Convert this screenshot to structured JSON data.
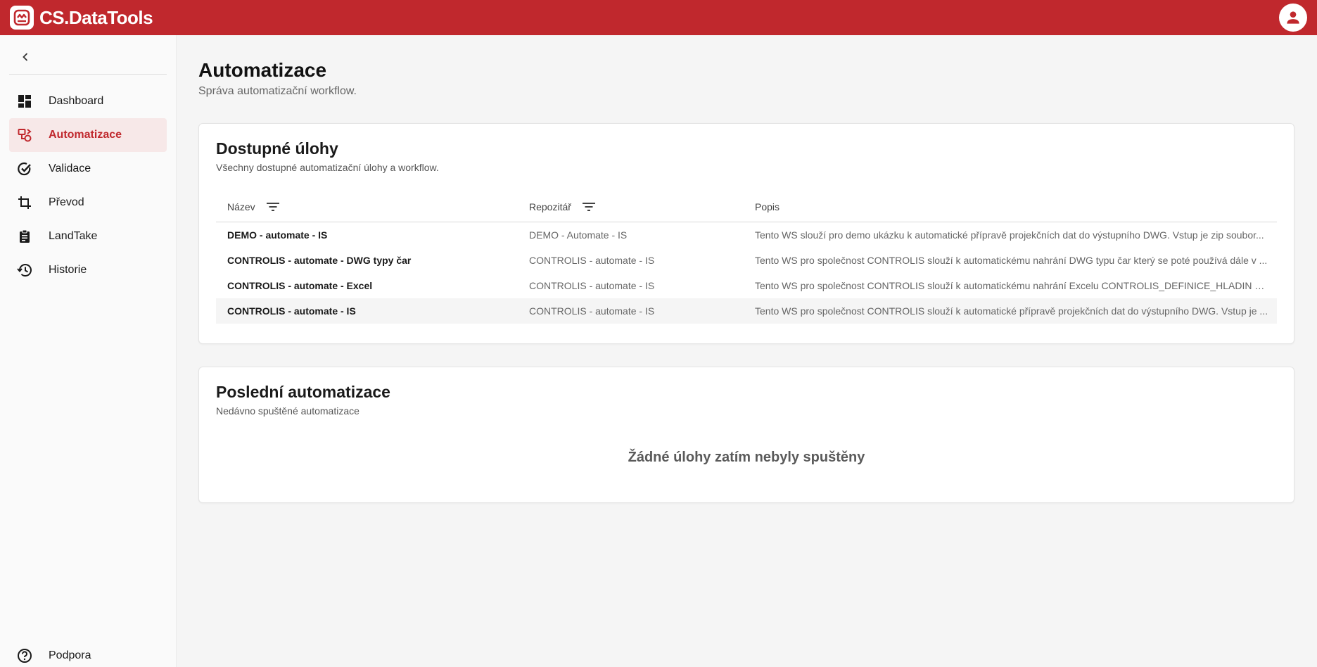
{
  "app": {
    "name": "CS.DataTools",
    "brand_color": "#c0282d"
  },
  "header": {
    "avatar_icon": "account-circle-icon"
  },
  "sidebar": {
    "collapse_icon": "chevron-left-icon",
    "items": [
      {
        "label": "Dashboard",
        "icon": "dashboard-icon",
        "active": false
      },
      {
        "label": "Automatizace",
        "icon": "automation-icon",
        "active": true
      },
      {
        "label": "Validace",
        "icon": "check-circle-icon",
        "active": false
      },
      {
        "label": "Převod",
        "icon": "crop-transform-icon",
        "active": false
      },
      {
        "label": "LandTake",
        "icon": "clipboard-icon",
        "active": false
      },
      {
        "label": "Historie",
        "icon": "history-icon",
        "active": false
      }
    ],
    "support": {
      "label": "Podpora",
      "icon": "help-circle-icon"
    }
  },
  "page": {
    "title": "Automatizace",
    "subtitle": "Správa automatizační workflow."
  },
  "available": {
    "title": "Dostupné úlohy",
    "subtitle": "Všechny dostupné automatizační úlohy a workflow.",
    "columns": {
      "name": "Název",
      "repo": "Repozitář",
      "desc": "Popis"
    },
    "rows": [
      {
        "name": "DEMO - automate - IS",
        "repo": "DEMO - Automate - IS",
        "desc": "Tento WS slouží pro demo ukázku k automatické přípravě projekčních dat do výstupního DWG. Vstup je zip soubor..."
      },
      {
        "name": "CONTROLIS - automate - DWG typy čar",
        "repo": "CONTROLIS - automate - IS",
        "desc": "Tento WS pro společnost CONTROLIS slouží k automatickému nahrání DWG typu čar který se poté používá dále v ..."
      },
      {
        "name": "CONTROLIS - automate - Excel",
        "repo": "CONTROLIS - automate - IS",
        "desc": "Tento WS pro společnost CONTROLIS slouží k automatickému nahrání Excelu CONTROLIS_DEFINICE_HLADIN kter..."
      },
      {
        "name": "CONTROLIS - automate - IS",
        "repo": "CONTROLIS - automate - IS",
        "desc": "Tento WS pro společnost CONTROLIS slouží k automatické přípravě projekčních dat do výstupního DWG. Vstup je ..."
      }
    ]
  },
  "recent": {
    "title": "Poslední automatizace",
    "subtitle": "Nedávno spuštěné automatizace",
    "empty_text": "Žádné úlohy zatím nebyly spuštěny"
  }
}
